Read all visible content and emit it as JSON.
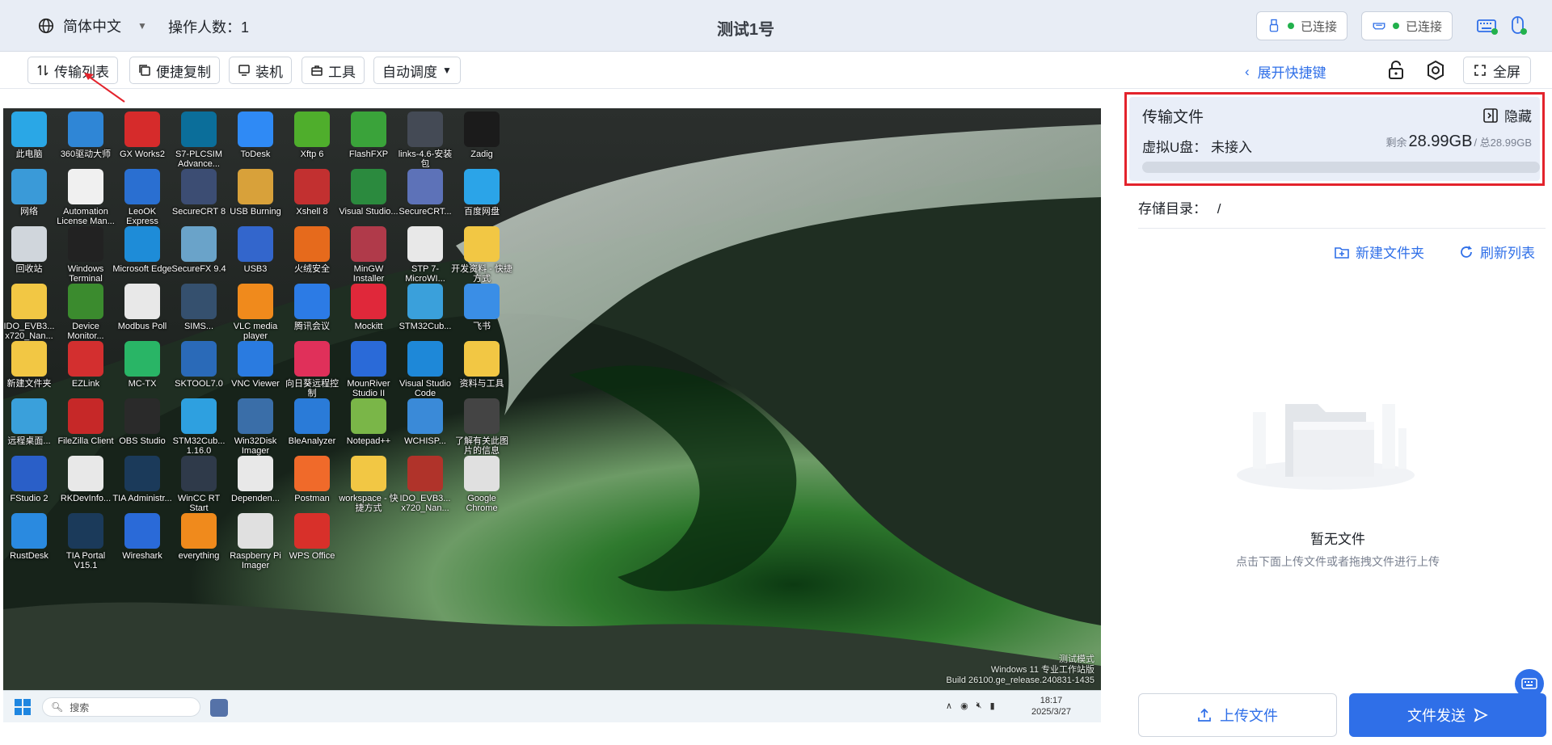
{
  "header": {
    "language": "简体中文",
    "operators_label": "操作人数：1",
    "title": "测试1号",
    "usb_status": "已连接",
    "display_status": "已连接",
    "status_color": "#22b14c"
  },
  "toolbar": {
    "transfer_list": "传输列表",
    "quick_copy": "便捷复制",
    "install": "装机",
    "tools": "工具",
    "auto_mode": "自动调度",
    "expand_shortcuts": "展开快捷键",
    "fullscreen": "全屏"
  },
  "desktop": {
    "icons": [
      {
        "label": "此电脑",
        "color": "#2aa7e6"
      },
      {
        "label": "360驱动大师",
        "color": "#2f86d6"
      },
      {
        "label": "GX Works2",
        "color": "#d62b2b"
      },
      {
        "label": "S7-PLCSIM Advance...",
        "color": "#0b6e9a"
      },
      {
        "label": "ToDesk",
        "color": "#2f8af5"
      },
      {
        "label": "Xftp 6",
        "color": "#4fae2c"
      },
      {
        "label": "FlashFXP",
        "color": "#3aa33a"
      },
      {
        "label": "links-4.6-安装包",
        "color": "#444a55"
      },
      {
        "label": "Zadig",
        "color": "#1b1b1b"
      },
      {
        "label": "网络",
        "color": "#3a9ad8"
      },
      {
        "label": "Automation License Man...",
        "color": "#f0f0f0"
      },
      {
        "label": "LeoOK Express",
        "color": "#2a6fd1"
      },
      {
        "label": "SecureCRT 8",
        "color": "#3c4d73"
      },
      {
        "label": "USB Burning",
        "color": "#d8a13a"
      },
      {
        "label": "Xshell 8",
        "color": "#c23030"
      },
      {
        "label": "Visual Studio...",
        "color": "#2b8a3e"
      },
      {
        "label": "SecureCRT...",
        "color": "#5d72b8"
      },
      {
        "label": "百度网盘",
        "color": "#2ba4e8"
      },
      {
        "label": "回收站",
        "color": "#d0d6dc"
      },
      {
        "label": "Windows Terminal",
        "color": "#222222"
      },
      {
        "label": "Microsoft Edge",
        "color": "#1e8cd8"
      },
      {
        "label": "SecureFX 9.4",
        "color": "#6aa3c9"
      },
      {
        "label": "USB3",
        "color": "#3366cc"
      },
      {
        "label": "火绒安全",
        "color": "#e66a1c"
      },
      {
        "label": "MinGW Installer",
        "color": "#b03a4a"
      },
      {
        "label": "STP 7-MicroWI...",
        "color": "#e8e8e8"
      },
      {
        "label": "开发资料 - 快捷方式",
        "color": "#f2c744"
      },
      {
        "label": "IDO_EVB3... x720_Nan...",
        "color": "#f2c744"
      },
      {
        "label": "Device Monitor...",
        "color": "#3b8b2e"
      },
      {
        "label": "Modbus Poll",
        "color": "#e8e8e8"
      },
      {
        "label": "SIMS...",
        "color": "#35506e"
      },
      {
        "label": "VLC media player",
        "color": "#f08a1c"
      },
      {
        "label": "腾讯会议",
        "color": "#2c7be5"
      },
      {
        "label": "Mockitt",
        "color": "#e0283a"
      },
      {
        "label": "STM32Cub...",
        "color": "#3aa0db"
      },
      {
        "label": "飞书",
        "color": "#3a8ee6"
      },
      {
        "label": "新建文件夹",
        "color": "#f2c744"
      },
      {
        "label": "EZLink",
        "color": "#d32f2f"
      },
      {
        "label": "MC-TX",
        "color": "#29b566"
      },
      {
        "label": "SKTOOL7.0",
        "color": "#2a6ab8"
      },
      {
        "label": "VNC Viewer",
        "color": "#2a7be0"
      },
      {
        "label": "向日葵远程控制",
        "color": "#e0305a"
      },
      {
        "label": "MounRiver Studio II",
        "color": "#2a6ad8"
      },
      {
        "label": "Visual Studio Code",
        "color": "#1e88d8"
      },
      {
        "label": "资料与工具",
        "color": "#f2c744"
      },
      {
        "label": "远程桌面...",
        "color": "#3aa0db"
      },
      {
        "label": "FileZilla Client",
        "color": "#c62828"
      },
      {
        "label": "OBS Studio",
        "color": "#2a2a2a"
      },
      {
        "label": "STM32Cub... 1.16.0",
        "color": "#2ea0e0"
      },
      {
        "label": "Win32Disk Imager",
        "color": "#3a6ea8"
      },
      {
        "label": "BleAnalyzer",
        "color": "#2a7bd8"
      },
      {
        "label": "Notepad++",
        "color": "#7ab648"
      },
      {
        "label": "WCHISP...",
        "color": "#3a8ad8"
      },
      {
        "label": "了解有关此图片的信息",
        "color": "#444444"
      },
      {
        "label": "FStudio 2",
        "color": "#2a5fc8"
      },
      {
        "label": "RKDevInfo...",
        "color": "#e8e8e8"
      },
      {
        "label": "TIA Administr...",
        "color": "#1b3a5a"
      },
      {
        "label": "WinCC RT Start",
        "color": "#2f3a4a"
      },
      {
        "label": "Dependen...",
        "color": "#e8e8e8"
      },
      {
        "label": "Postman",
        "color": "#f06a2a"
      },
      {
        "label": "workspace - 快捷方式",
        "color": "#f2c744"
      },
      {
        "label": "IDO_EVB3... x720_Nan...",
        "color": "#b0332a"
      },
      {
        "label": "Google Chrome",
        "color": "#e0e0e0"
      },
      {
        "label": "RustDesk",
        "color": "#2a8ae0"
      },
      {
        "label": "TIA Portal V15.1",
        "color": "#1b3a5a"
      },
      {
        "label": "Wireshark",
        "color": "#2a6ad8"
      },
      {
        "label": "everything",
        "color": "#f08a1c"
      },
      {
        "label": "Raspberry Pi Imager",
        "color": "#e0e0e0"
      },
      {
        "label": "WPS Office",
        "color": "#d8302a"
      }
    ],
    "watermark_line1": "测试模式",
    "watermark_line2": "Windows 11 专业工作站版",
    "watermark_line3": "Build 26100.ge_release.240831-1435",
    "taskbar_search": "搜索",
    "clock_time": "18:17",
    "clock_date": "2025/3/27"
  },
  "panel": {
    "title": "传输文件",
    "hide": "隐藏",
    "vdisk_label": "虚拟U盘：",
    "vdisk_status": "未接入",
    "remaining_prefix": "剩余",
    "remaining": "28.99GB",
    "total": "/ 总28.99GB",
    "storage_dir_label": "存储目录：",
    "storage_dir_value": "/",
    "new_folder": "新建文件夹",
    "refresh": "刷新列表",
    "empty_title": "暂无文件",
    "empty_hint": "点击下面上传文件或者拖拽文件进行上传",
    "upload": "上传文件",
    "send": "文件发送",
    "accent": "#2f6fe8",
    "highlight": "#e3232c"
  }
}
